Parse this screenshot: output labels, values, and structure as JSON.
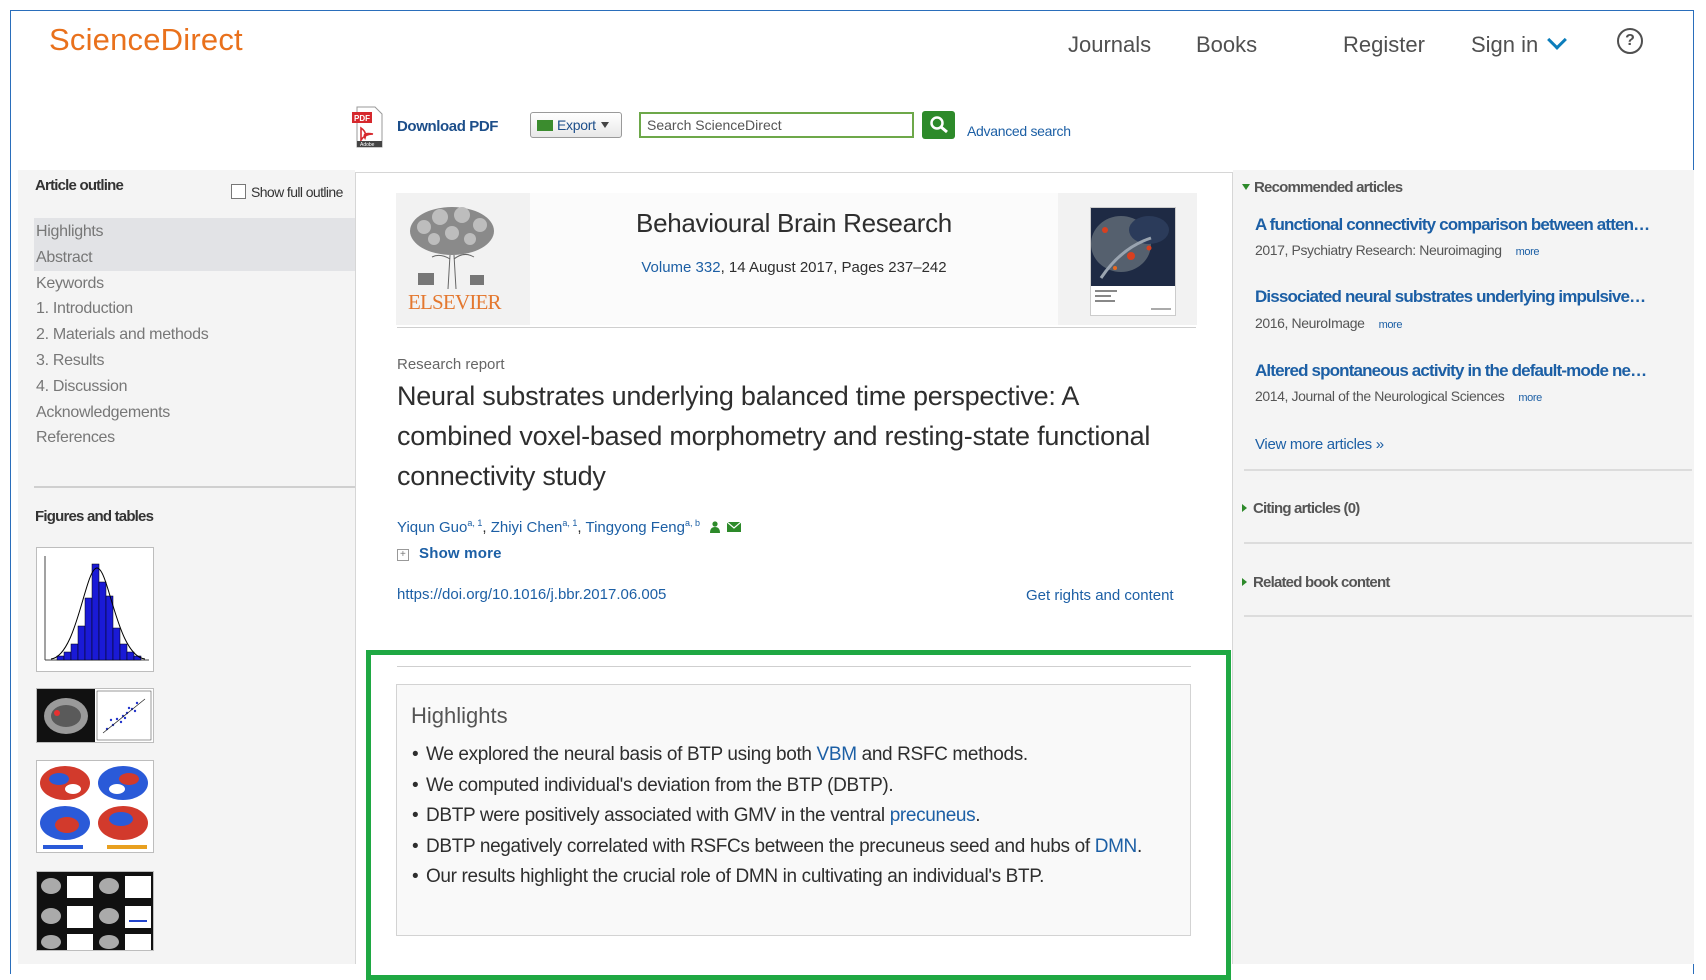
{
  "header": {
    "brand": "ScienceDirect",
    "nav": {
      "journals": "Journals",
      "books": "Books",
      "register": "Register",
      "signin": "Sign in"
    },
    "help_glyph": "?",
    "icons": {
      "signin_chevron": "chevron-down-icon",
      "help": "help-icon"
    }
  },
  "toolbar": {
    "download_pdf": "Download PDF",
    "export": "Export",
    "search_placeholder": "Search ScienceDirect",
    "advanced_search": "Advanced search",
    "pdf_icon_text": "PDF",
    "pdf_icon_subtext": "Adobe"
  },
  "left": {
    "outline_title": "Article outline",
    "show_full_outline": "Show full outline",
    "outline_items": [
      "Highlights",
      "Abstract",
      "Keywords",
      "1. Introduction",
      "2. Materials and methods",
      "3. Results",
      "4. Discussion",
      "Acknowledgements",
      "References"
    ],
    "figures_title": "Figures and tables"
  },
  "article": {
    "publisher": "ELSEVIER",
    "journal": "Behavioural Brain Research",
    "volume_link": "Volume 332",
    "volume_rest": ", 14 August 2017, Pages 237–242",
    "type": "Research report",
    "title": "Neural substrates underlying balanced time perspective: A combined voxel-based morphometry and resting-state functional connectivity study",
    "authors": [
      {
        "name": "Yiqun Guo",
        "sup": "a, 1"
      },
      {
        "name": "Zhiyi Chen",
        "sup": "a, 1"
      },
      {
        "name": "Tingyong Feng",
        "sup": "a, b"
      }
    ],
    "author_sep": ", ",
    "show_more": "Show more",
    "doi": "https://doi.org/10.1016/j.bbr.2017.06.005",
    "rights": "Get rights and content",
    "highlights": {
      "title": "Highlights",
      "bullet": "•",
      "items": [
        {
          "pre": "We explored the neural basis of BTP using both ",
          "link": "VBM",
          "post": " and RSFC methods."
        },
        {
          "pre": "We computed individual's deviation from the BTP (DBTP).",
          "link": "",
          "post": ""
        },
        {
          "pre": "DBTP were positively associated with GMV in the ventral ",
          "link": "precuneus",
          "post": "."
        },
        {
          "pre": "DBTP negatively correlated with RSFCs between the precuneus seed and hubs of ",
          "link": "DMN",
          "post": "."
        },
        {
          "pre": "Our results highlight the crucial role of DMN in cultivating an individual's BTP.",
          "link": "",
          "post": ""
        }
      ]
    },
    "highlight_frame_color": "#1fa843"
  },
  "right": {
    "recommended_title": "Recommended articles",
    "recommended": [
      {
        "title": "A functional connectivity comparison between atten…",
        "meta": "2017, Psychiatry Research: Neuroimaging",
        "more": "more"
      },
      {
        "title": "Dissociated neural substrates underlying impulsive…",
        "meta": "2016, NeuroImage",
        "more": "more"
      },
      {
        "title": "Altered spontaneous activity in the default-mode ne…",
        "meta": "2014, Journal of the Neurological Sciences",
        "more": "more"
      }
    ],
    "view_more": "View more articles »",
    "citing": "Citing articles (0)",
    "related": "Related book content"
  },
  "colors": {
    "brand": "#e9711c",
    "link": "#1c5fa5",
    "search_green": "#2d8a2a"
  }
}
